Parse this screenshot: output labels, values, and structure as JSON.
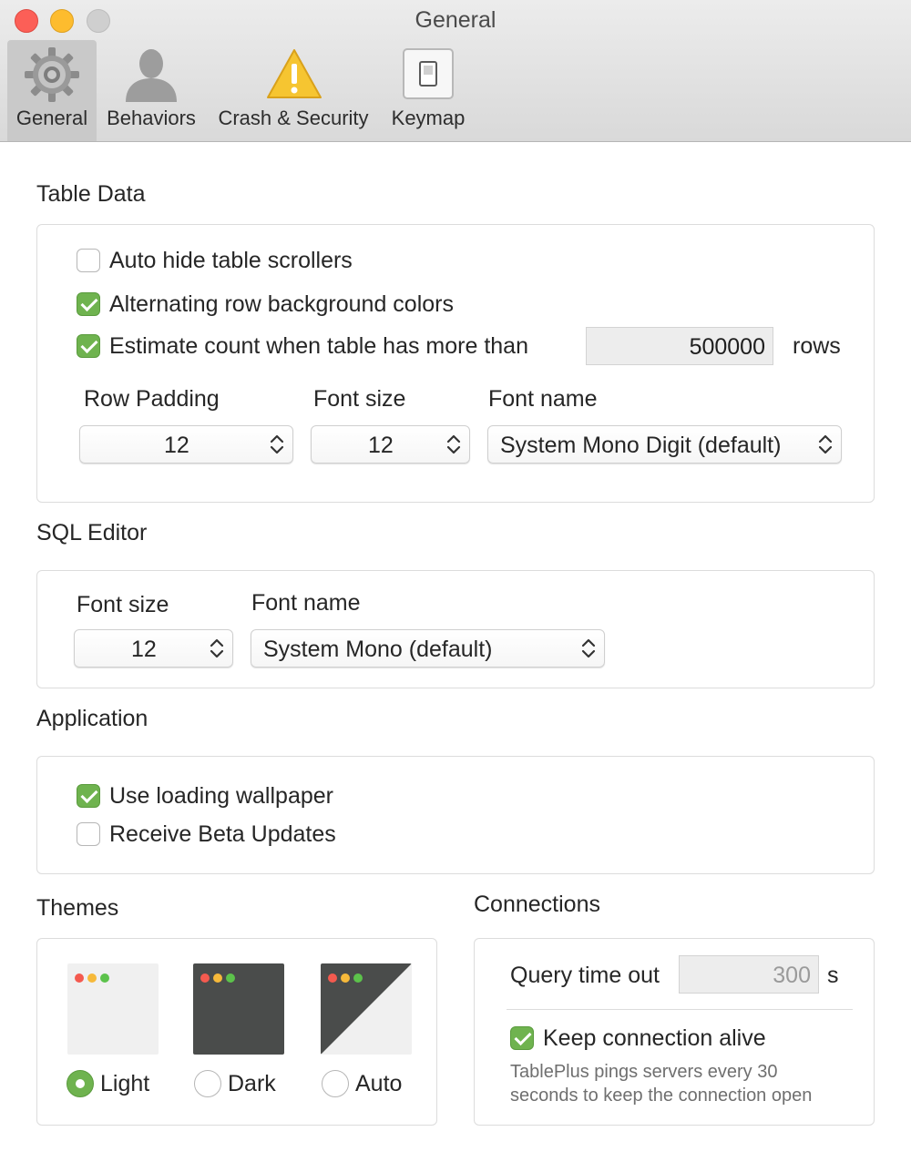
{
  "window": {
    "title": "General"
  },
  "toolbar": {
    "tabs": [
      {
        "label": "General",
        "icon": "gear-icon"
      },
      {
        "label": "Behaviors",
        "icon": "person-icon"
      },
      {
        "label": "Crash & Security",
        "icon": "warning-icon"
      },
      {
        "label": "Keymap",
        "icon": "switch-icon"
      }
    ],
    "active_tab": "General"
  },
  "table_data": {
    "title": "Table Data",
    "auto_hide": {
      "label": "Auto hide table scrollers",
      "checked": false
    },
    "alternating": {
      "label": "Alternating row background colors",
      "checked": true
    },
    "estimate": {
      "label": "Estimate count when table has more than",
      "checked": true,
      "value": "500000",
      "unit": "rows"
    },
    "row_padding": {
      "label": "Row Padding",
      "value": "12"
    },
    "font_size": {
      "label": "Font size",
      "value": "12"
    },
    "font_name": {
      "label": "Font name",
      "value": "System Mono Digit (default)"
    }
  },
  "sql_editor": {
    "title": "SQL Editor",
    "font_size": {
      "label": "Font size",
      "value": "12"
    },
    "font_name": {
      "label": "Font name",
      "value": "System Mono (default)"
    }
  },
  "application": {
    "title": "Application",
    "loading_wallpaper": {
      "label": "Use loading wallpaper",
      "checked": true
    },
    "beta_updates": {
      "label": "Receive Beta Updates",
      "checked": false
    }
  },
  "themes": {
    "title": "Themes",
    "options": [
      {
        "label": "Light",
        "selected": true
      },
      {
        "label": "Dark",
        "selected": false
      },
      {
        "label": "Auto",
        "selected": false
      }
    ]
  },
  "connections": {
    "title": "Connections",
    "query_timeout": {
      "label": "Query time out",
      "value": "300",
      "unit": "s"
    },
    "keep_alive": {
      "label": "Keep connection alive",
      "checked": true
    },
    "description_line1": "TablePlus pings servers every 30",
    "description_line2": "seconds to keep the connection open"
  },
  "colors": {
    "accent_green": "#6fb34f",
    "close": "#fc5f57",
    "minimize": "#fdbc2e",
    "dark_theme": "#4a4c4b",
    "light_theme": "#f0f0f0"
  }
}
